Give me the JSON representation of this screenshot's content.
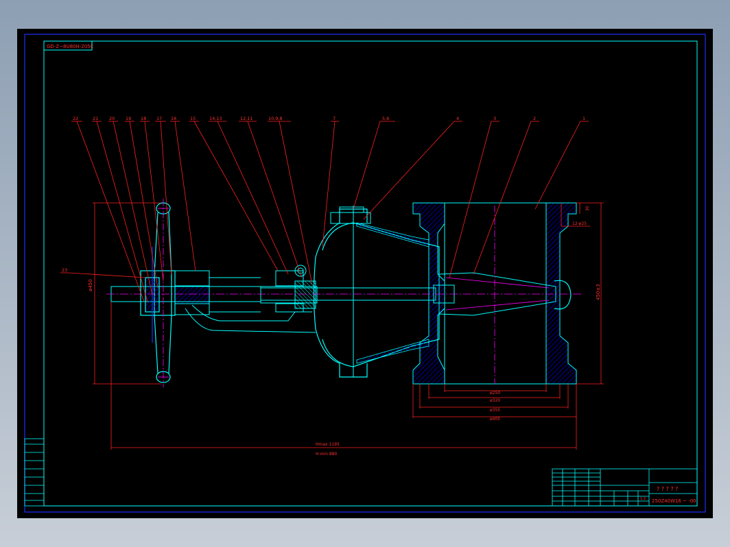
{
  "drawing_code": "GD-Z~8U80H-205C",
  "part_numbers": [
    "22",
    "21",
    "20",
    "19",
    "18",
    "17",
    "16",
    "15",
    "14,13",
    "12,11",
    "10,9,8",
    "7",
    "5,6",
    "4",
    "3",
    "2",
    "1",
    "23"
  ],
  "dimensions": {
    "handwheel_dia": "ø450",
    "height_right": "450±3",
    "bolt_label": "12-ø25",
    "bolt_offset": "30",
    "d250": "ø250",
    "d320": "ø320",
    "d355": "ø355",
    "d405": "ø405",
    "hmax": "Hmax 1195",
    "hmin": "H-min 880"
  },
  "title_block": {
    "title_marks": "? ? ? ? ?",
    "drawing_no": "250Z40W16 ~ -00",
    "ratio": "1:2"
  },
  "colors": {
    "frame": "#00ffff",
    "outer_frame": "#0000ff",
    "leader": "#ff0000",
    "outline": "#00ffff",
    "center": "#ff00ff",
    "text": "#ff0000"
  }
}
